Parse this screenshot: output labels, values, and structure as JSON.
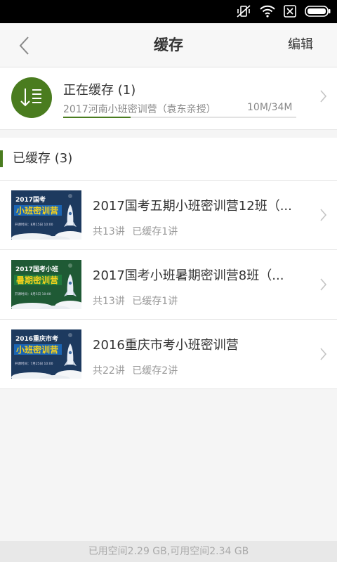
{
  "header": {
    "title": "缓存",
    "edit_label": "编辑"
  },
  "downloading": {
    "title": "正在缓存 (1)",
    "subtitle": "2017河南小班密训营（袁东亲授）",
    "size": "10M/34M",
    "progress_fraction": 0.29
  },
  "downloaded": {
    "label": "已缓存 (3)",
    "items": [
      {
        "title": "2017国考五期小班密训营12班（...",
        "lessons": "共13讲",
        "cached": "已缓存1讲",
        "thumb": {
          "year": "2017国考",
          "banner": "小班密训营",
          "date": "开课时间：8月15日 10:00",
          "bg": "#1d3a5f",
          "bar": "#1b65b4"
        }
      },
      {
        "title": "2017国考小班暑期密训营8班（...",
        "lessons": "共13讲",
        "cached": "已缓存1讲",
        "thumb": {
          "year": "2017国考小班",
          "banner": "暑期密训营",
          "date": "开课时间：8月5日 10:00",
          "bg": "#1f5a35",
          "bar": "#1f7a3e"
        }
      },
      {
        "title": "2016重庆市考小班密训营",
        "lessons": "共22讲",
        "cached": "已缓存2讲",
        "thumb": {
          "year": "2016重庆市考",
          "banner": "小班密训营",
          "date": "开课时间：7月25日 10:00",
          "bg": "#1d3a5f",
          "bar": "#1b65b4"
        }
      }
    ]
  },
  "footer": {
    "storage": "已用空间2.29 GB,可用空间2.34 GB"
  },
  "colors": {
    "accent": "#4a7c1f",
    "banner_text": "#f6d11c"
  }
}
